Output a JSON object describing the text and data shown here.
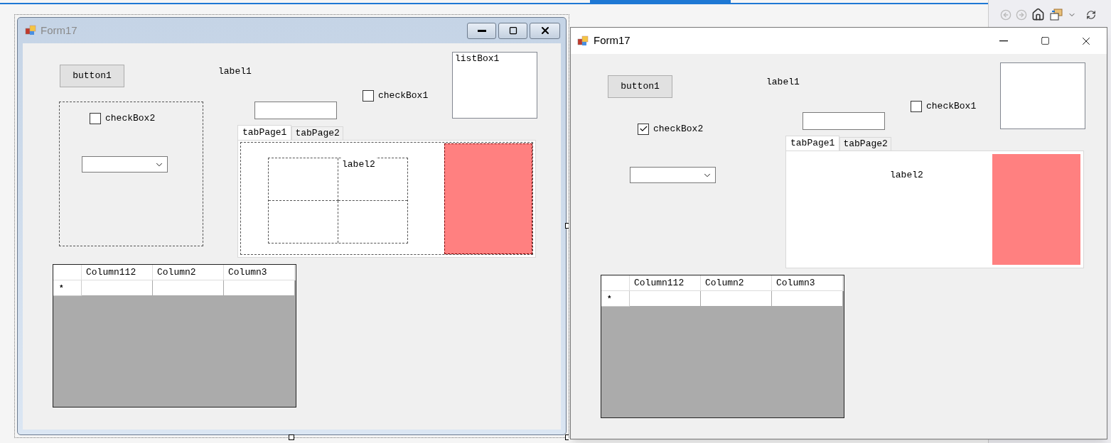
{
  "forms": [
    {
      "kind": "designer",
      "title": "Form17",
      "button": "button1",
      "label1": "label1",
      "label2": "label2",
      "listbox_items": [
        "listBox1"
      ],
      "checkbox1": {
        "label": "checkBox1",
        "checked": false
      },
      "checkbox2": {
        "label": "checkBox2",
        "checked": false
      },
      "tabs": [
        {
          "label": "tabPage1",
          "selected": true
        },
        {
          "label": "tabPage2",
          "selected": false
        }
      ],
      "grid": {
        "columns": [
          "Column112",
          "Column2",
          "Column3"
        ],
        "new_row_marker": "*"
      }
    },
    {
      "kind": "running",
      "title": "Form17",
      "button": "button1",
      "label1": "label1",
      "label2": "label2",
      "checkbox1": {
        "label": "checkBox1",
        "checked": false
      },
      "checkbox2": {
        "label": "checkBox2",
        "checked": true
      },
      "tabs": [
        {
          "label": "tabPage1",
          "selected": true
        },
        {
          "label": "tabPage2",
          "selected": false
        }
      ],
      "grid": {
        "columns": [
          "Column112",
          "Column2",
          "Column3"
        ],
        "new_row_marker": "*"
      }
    }
  ]
}
